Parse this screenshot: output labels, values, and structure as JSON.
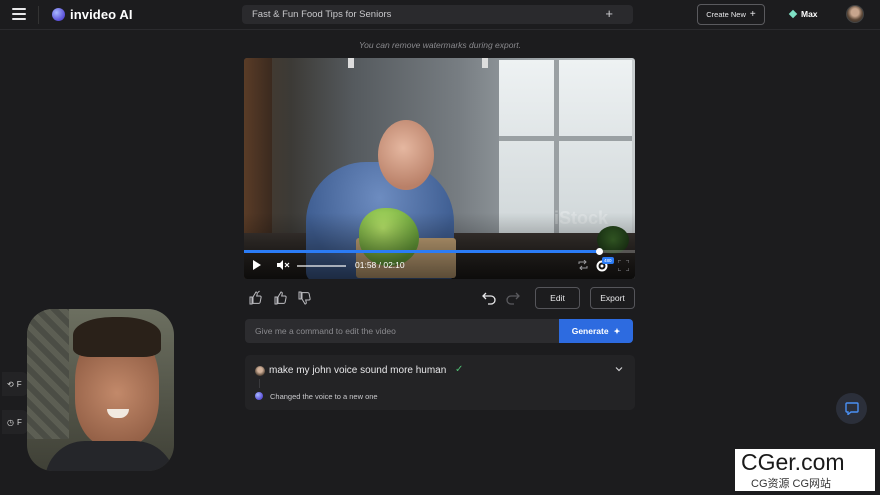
{
  "header": {
    "app_name": "invideo AI",
    "project_title": "Fast & Fun Food Tips for Seniors",
    "create_new_label": "Create New",
    "plan_label": "Max"
  },
  "notice": "You can remove watermarks during export.",
  "video": {
    "time_display": "01:58 / 02:10",
    "progress_fraction": 0.908,
    "quality_badge": "480",
    "stock_watermark": "iStock"
  },
  "actions": {
    "edit_label": "Edit",
    "export_label": "Export"
  },
  "command": {
    "placeholder": "Give me a command to edit the video",
    "generate_label": "Generate"
  },
  "history": [
    {
      "user_command": "make my john voice sound more human",
      "response": "Changed the voice to a new one"
    }
  ],
  "side_chips": [
    "F",
    "F"
  ],
  "site_watermark": {
    "main": "CGer.com",
    "sub": "CG资源 CG网站"
  },
  "colors": {
    "accent": "#2d6be0",
    "progress": "#2b7cf6",
    "success": "#4fbf73",
    "background": "#1c1c1e"
  }
}
